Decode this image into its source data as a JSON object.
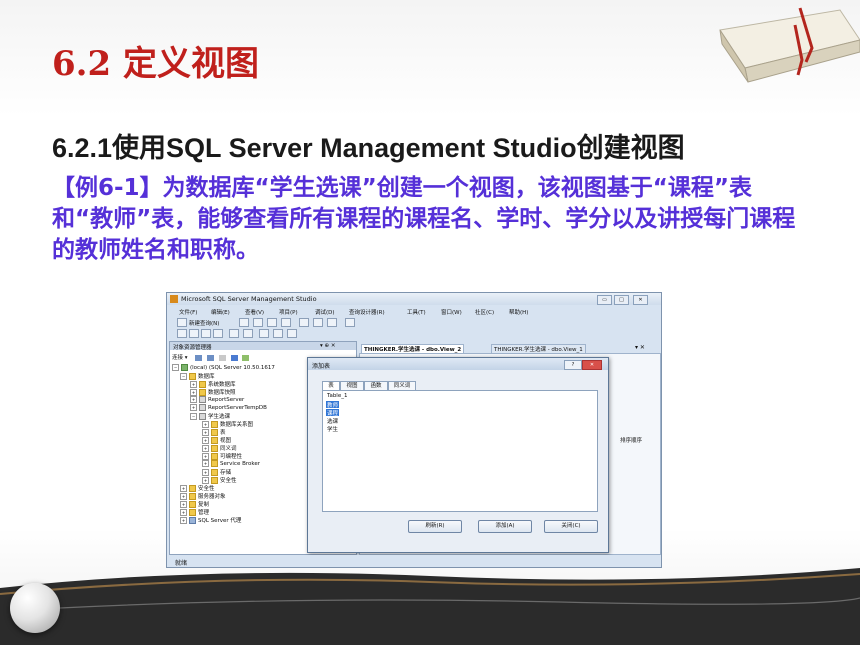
{
  "slide": {
    "title": "6.2 定义视图",
    "subtitle": "6.2.1使用SQL Server Management Studio创建视图",
    "example": "【例6-1】为数据库“学生选课”创建一个视图，该视图基于“课程”表和“教师”表，能够查看所有课程的课程名、学时、学分以及讲授每门课程的教师姓名和职称。"
  },
  "window": {
    "title": "Microsoft SQL Server Management Studio",
    "menu": [
      "文件(F)",
      "编辑(E)",
      "查看(V)",
      "项目(P)",
      "调试(D)",
      "查询设计器(R)",
      "工具(T)",
      "窗口(W)",
      "社区(C)",
      "帮助(H)"
    ],
    "new_query": "新建查询(N)",
    "status": "就绪"
  },
  "object_explorer": {
    "title": "对象资源管理器",
    "pin": "▾ ⊕ ✕",
    "toolbar": "连接 ▾",
    "tree": [
      {
        "label": "(local) (SQL Server 10.50.1617"
      },
      {
        "label": "数据库"
      },
      {
        "label": "系统数据库"
      },
      {
        "label": "数据库快照"
      },
      {
        "label": "ReportServer"
      },
      {
        "label": "ReportServerTempDB"
      },
      {
        "label": "学生选课"
      },
      {
        "label": "数据库关系图"
      },
      {
        "label": "表"
      },
      {
        "label": "视图"
      },
      {
        "label": "同义词"
      },
      {
        "label": "可编程性"
      },
      {
        "label": "Service Broker"
      },
      {
        "label": "存储"
      },
      {
        "label": "安全性"
      },
      {
        "label": "安全性"
      },
      {
        "label": "服务器对象"
      },
      {
        "label": "复制"
      },
      {
        "label": "管理"
      },
      {
        "label": "SQL Server 代理"
      }
    ]
  },
  "documents": {
    "tabs": [
      "THINGKER.学生选课 - dbo.View_2",
      "THINGKER.学生选课 - dbo.View_1"
    ],
    "property_label": "排序顺序"
  },
  "dialog": {
    "title": "添加表",
    "help": "?",
    "close": "✕",
    "tabs": [
      "表",
      "视图",
      "函数",
      "同义词"
    ],
    "items": [
      {
        "label": "Table_1",
        "selected": false
      },
      {
        "label": "教师",
        "selected": true
      },
      {
        "label": "课程",
        "selected": true
      },
      {
        "label": "选课",
        "selected": false
      },
      {
        "label": "学生",
        "selected": false
      }
    ],
    "buttons": {
      "refresh": "刷新(R)",
      "add": "添加(A)",
      "close": "关闭(C)"
    }
  },
  "colors": {
    "title": "#c0201c",
    "example": "#5530d8",
    "selection": "#3176d6"
  }
}
